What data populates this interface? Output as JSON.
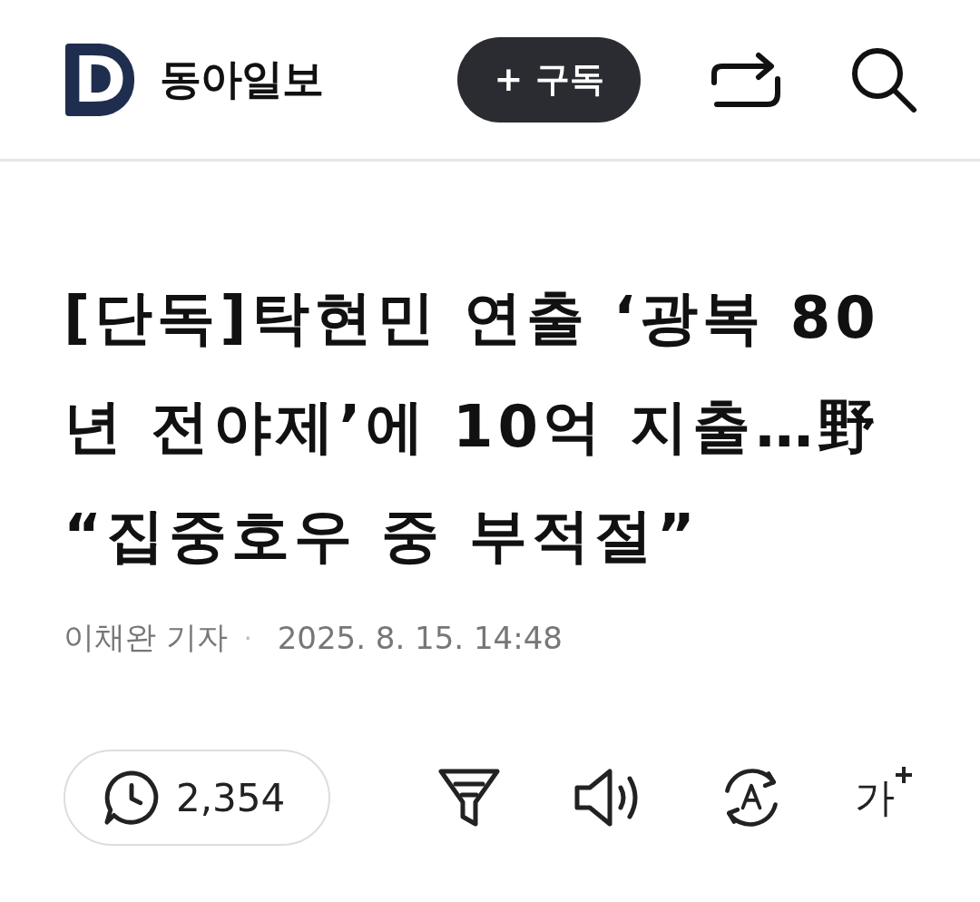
{
  "header": {
    "logo_letter": "D",
    "brand": "동아일보",
    "subscribe": "+ 구독"
  },
  "article": {
    "headline": "[단독]탁현민 연출 ‘광복 80년 전야제’에 10억 지출…野 “집중호우 중 부적절”",
    "author": "이채완 기자",
    "separator": "·",
    "datetime": "2025. 8. 15. 14:48"
  },
  "toolbar": {
    "comments": "2,354",
    "font_size_label": "가"
  }
}
